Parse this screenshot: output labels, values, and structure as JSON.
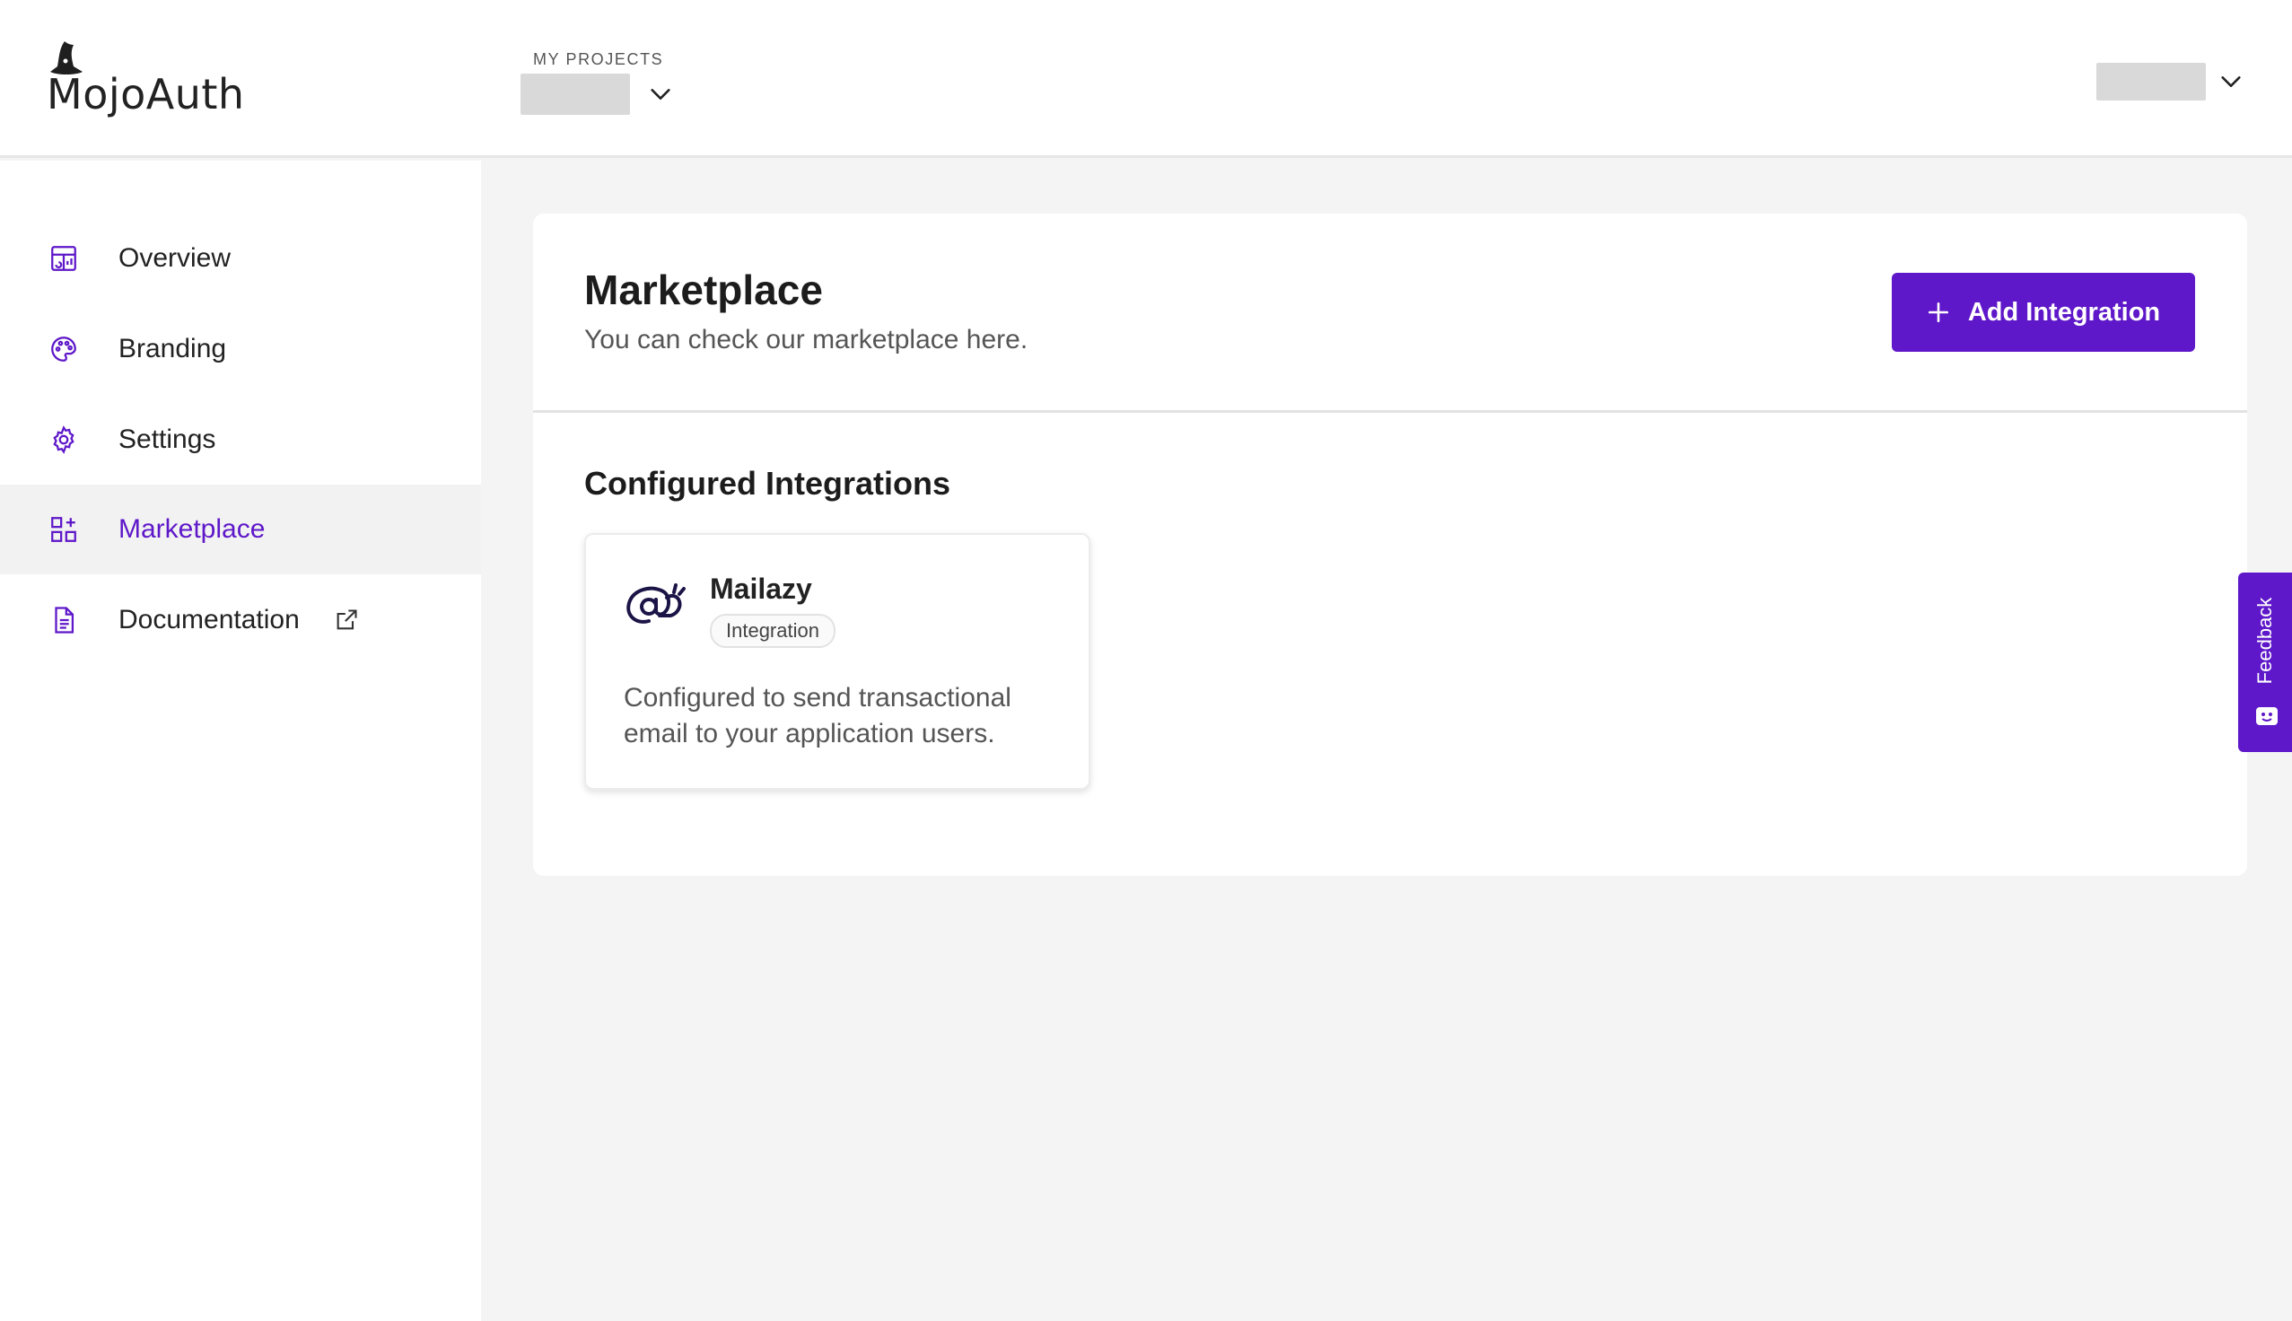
{
  "header": {
    "logo_text": "MojoAuth",
    "projects_label": "MY PROJECTS"
  },
  "sidebar": {
    "items": [
      {
        "label": "Overview",
        "icon": "dashboard-icon",
        "active": false
      },
      {
        "label": "Branding",
        "icon": "palette-icon",
        "active": false
      },
      {
        "label": "Settings",
        "icon": "gear-icon",
        "active": false
      },
      {
        "label": "Marketplace",
        "icon": "apps-add-icon",
        "active": true
      },
      {
        "label": "Documentation",
        "icon": "document-icon",
        "active": false,
        "external": true
      }
    ]
  },
  "main": {
    "title": "Marketplace",
    "subtitle": "You can check our marketplace here.",
    "add_button_label": "Add Integration",
    "section_title": "Configured Integrations",
    "integrations": [
      {
        "name": "Mailazy",
        "badge": "Integration",
        "description": "Configured to send transactional email to your application users.",
        "icon": "mailazy-snail-icon"
      }
    ]
  },
  "feedback": {
    "label": "Feedback"
  },
  "colors": {
    "accent": "#5e17c9",
    "background": "#f4f4f4",
    "card": "#ffffff",
    "placeholder": "#d9d9d9"
  }
}
